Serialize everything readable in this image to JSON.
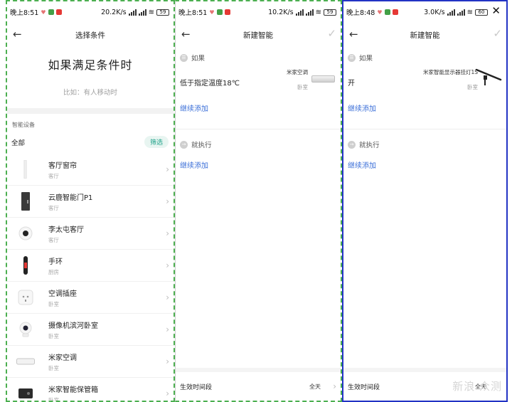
{
  "panel1": {
    "status": {
      "time": "晚上8:51",
      "speed": "20.2K/s",
      "battery": "59"
    },
    "title": "选择条件",
    "heading": "如果满足条件时",
    "hint": "比如：有人移动时",
    "section_label": "智能设备",
    "filter_all": "全部",
    "filter_button": "筛选",
    "devices": [
      {
        "name": "客厅窗帘",
        "room": "客厅",
        "icon": "curtain-icon"
      },
      {
        "name": "云鹿智能门P1",
        "room": "客厅",
        "icon": "smart-door-icon"
      },
      {
        "name": "李太屯客厅",
        "room": "客厅",
        "icon": "camera-icon"
      },
      {
        "name": "手环",
        "room": "厨房",
        "icon": "band-icon"
      },
      {
        "name": "空调插座",
        "room": "卧室",
        "icon": "plug-icon"
      },
      {
        "name": "摄像机滨河卧室",
        "room": "卧室",
        "icon": "camera-icon"
      },
      {
        "name": "米家空调",
        "room": "卧室",
        "icon": "ac-icon"
      },
      {
        "name": "米家智能保管箱",
        "room": "卧室",
        "icon": "safe-box-icon"
      }
    ]
  },
  "panel2": {
    "status": {
      "time": "晚上8:51",
      "speed": "10.2K/s",
      "battery": "59"
    },
    "title": "新建智能",
    "if_label": "如果",
    "condition": "低于指定温度18℃",
    "device_name": "米家空调",
    "device_room": "卧室",
    "add_condition": "继续添加",
    "then_label": "就执行",
    "add_action": "继续添加",
    "footer_label": "生效时间段",
    "footer_value": "全天"
  },
  "panel3": {
    "status": {
      "time": "晚上8:48",
      "speed": "3.0K/s",
      "battery": "60"
    },
    "title": "新建智能",
    "if_label": "如果",
    "condition": "开",
    "device_name": "米家智能显示器挂灯1S",
    "device_room": "卧室",
    "add_condition": "继续添加",
    "then_label": "就执行",
    "add_action": "继续添加",
    "footer_label": "生效时间段",
    "footer_value": "全天",
    "watermark": "新浪 众测"
  }
}
